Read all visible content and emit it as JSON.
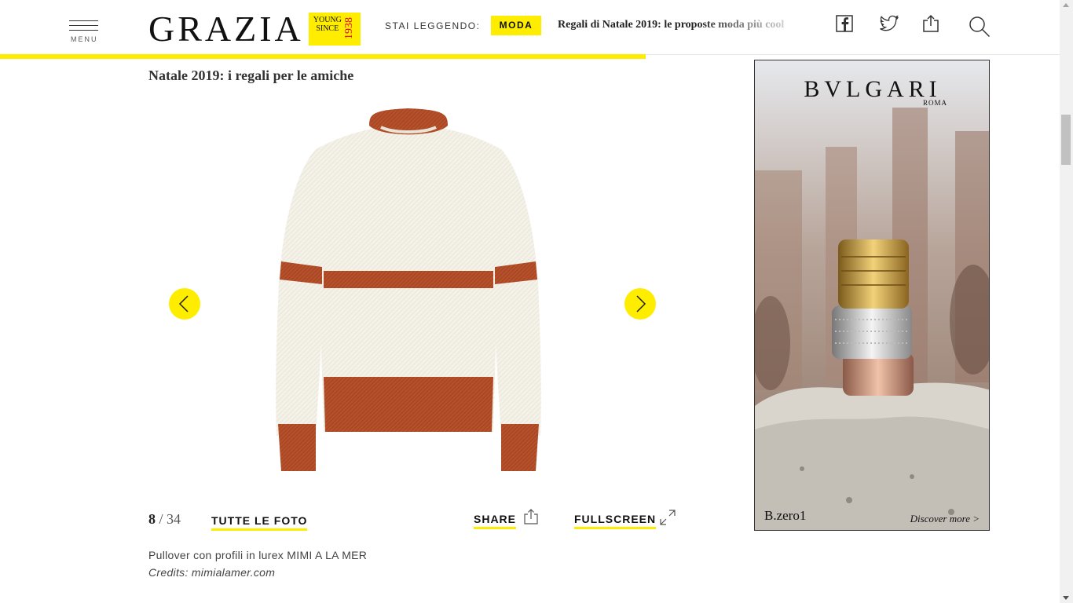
{
  "header": {
    "menu_label": "MENU",
    "logo": "GRAZIA",
    "logo_badge_line1": "YOUNG",
    "logo_badge_line2": "SINCE",
    "logo_badge_year": "1938",
    "reading_label": "STAI LEGGENDO:",
    "category": "MODA",
    "reading_title": "Regali di Natale 2019: le proposte moda più cool",
    "icons": [
      "facebook-icon",
      "twitter-icon",
      "share-icon",
      "search-icon"
    ],
    "reading_progress_percent": 60
  },
  "gallery": {
    "title": "Natale 2019: i regali per le amiche",
    "current": "8",
    "separator": "/",
    "total": "34",
    "all_photos_label": "TUTTE LE FOTO",
    "share_label": "SHARE",
    "fullscreen_label": "FULLSCREEN",
    "caption": "Pullover con profili in lurex MIMI A LA MER",
    "credits": "Credits: mimialamer.com"
  },
  "ad": {
    "brand": "BVLGARI",
    "brand_sub": "ROMA",
    "product": "B.zero1",
    "cta": "Discover more >"
  },
  "colors": {
    "accent": "#ffed00",
    "sweater_stripe": "#b5502a",
    "sweater_body": "#f4f1e8"
  }
}
